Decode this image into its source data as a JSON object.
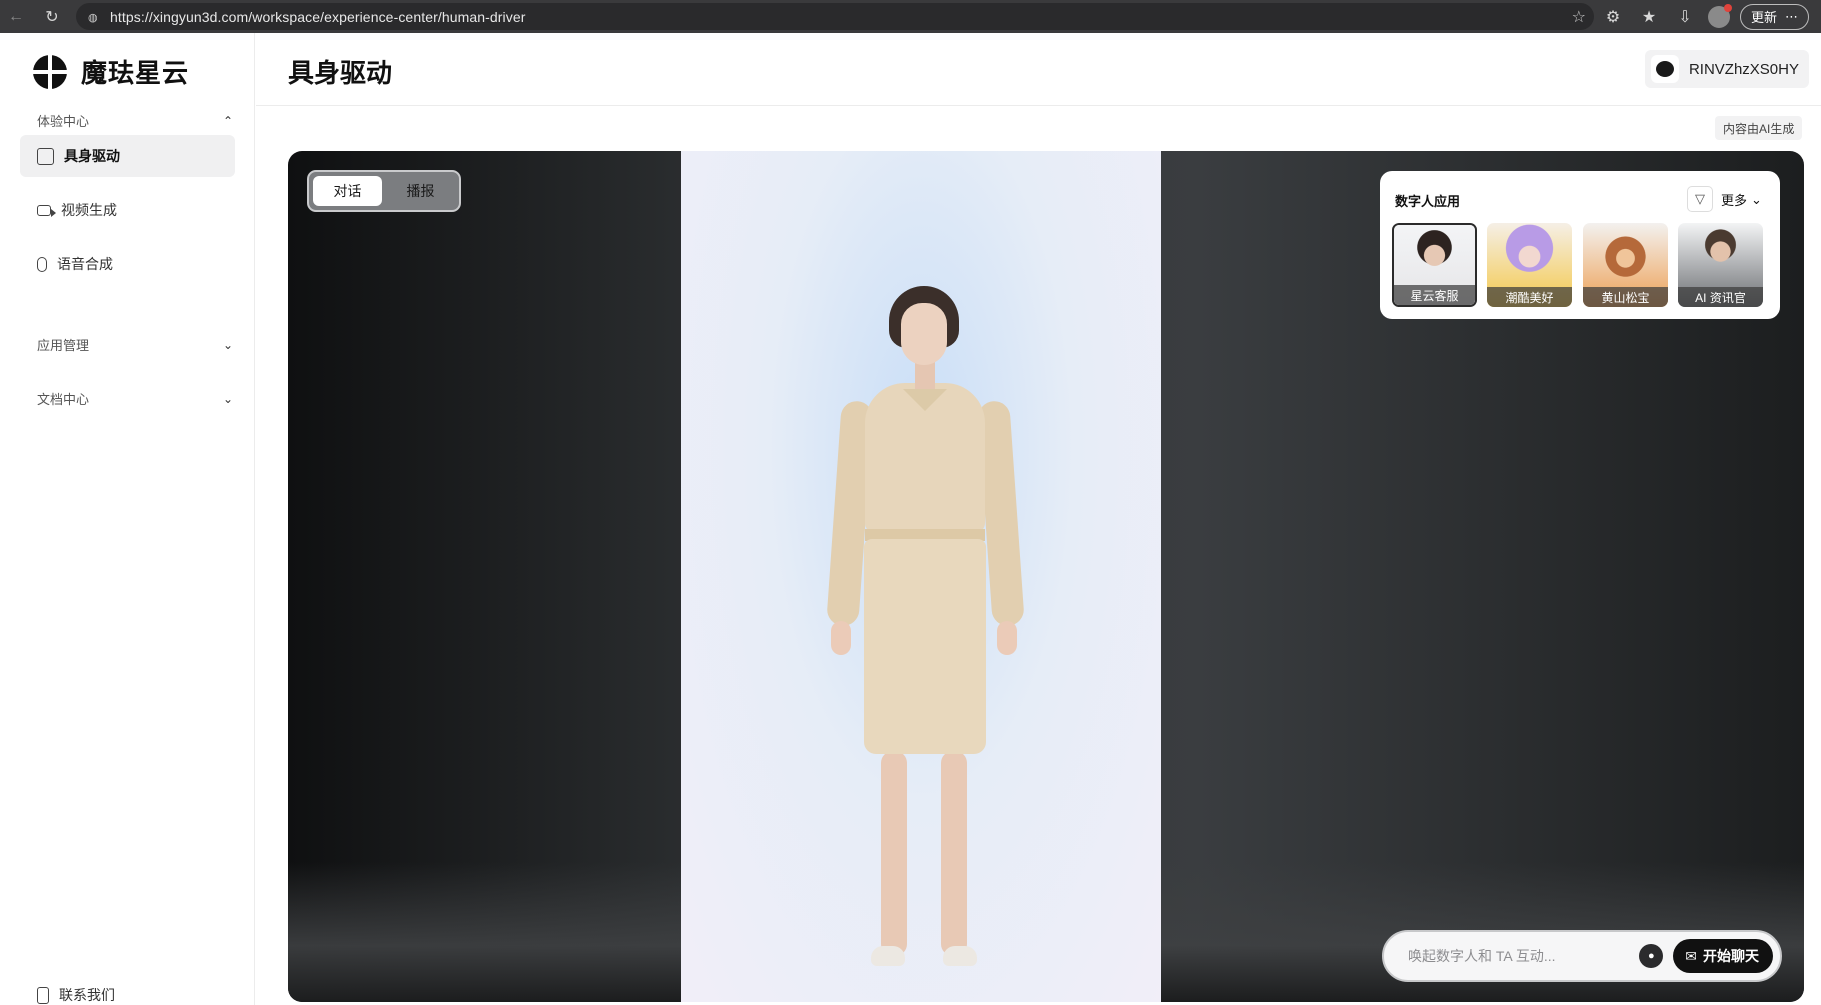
{
  "browser": {
    "url": "https://xingyun3d.com/workspace/experience-center/human-driver",
    "update_label": "更新"
  },
  "sidebar": {
    "brand": "魔珐星云",
    "groups": [
      {
        "title": "体验中心",
        "expanded": true
      },
      {
        "title": "应用管理",
        "expanded": false
      },
      {
        "title": "文档中心",
        "expanded": false
      }
    ],
    "items": [
      {
        "label": "具身驱动",
        "icon": "home-icon",
        "active": true
      },
      {
        "label": "视频生成",
        "icon": "video-icon",
        "active": false
      },
      {
        "label": "语音合成",
        "icon": "mic-icon",
        "active": false
      }
    ],
    "contact_label": "联系我们"
  },
  "header": {
    "title": "具身驱动",
    "username": "RINVZhzXS0HY"
  },
  "ai_notice": "内容由AI生成",
  "stage": {
    "modes": [
      {
        "label": "对话",
        "active": true
      },
      {
        "label": "播报",
        "active": false
      }
    ],
    "panel": {
      "title": "数字人应用",
      "more_label": "更多",
      "characters": [
        {
          "name": "星云客服",
          "selected": true
        },
        {
          "name": "潮酷美好",
          "selected": false
        },
        {
          "name": "黄山松宝",
          "selected": false
        },
        {
          "name": "AI 资讯官",
          "selected": false
        }
      ]
    },
    "chat": {
      "placeholder": "唤起数字人和 TA 互动...",
      "start_label": "开始聊天"
    }
  }
}
